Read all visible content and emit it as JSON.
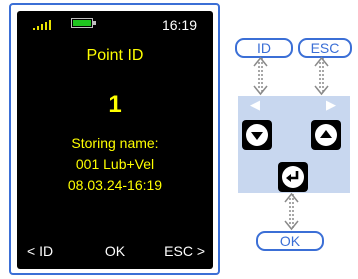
{
  "screen": {
    "status": {
      "time": "16:19",
      "signal_icon": "signal-icon",
      "battery_icon": "battery-icon"
    },
    "title": "Point ID",
    "point_number": "1",
    "info_lines": [
      "Storing name:",
      "001 Lub+Vel",
      "08.03.24-16:19"
    ],
    "softkeys": {
      "left": "< ID",
      "middle": "OK",
      "right": "ESC >"
    }
  },
  "keys": {
    "id_label": "ID",
    "esc_label": "ESC",
    "ok_label": "OK",
    "left_arrow": "◀",
    "right_arrow": "▶",
    "down_icon": "arrow-down-key-icon",
    "up_icon": "arrow-up-key-icon",
    "enter_icon": "enter-key-icon"
  },
  "colors": {
    "accent": "#3b6fd6",
    "display_text": "#ffff00",
    "panel": "#c8d7ef"
  }
}
